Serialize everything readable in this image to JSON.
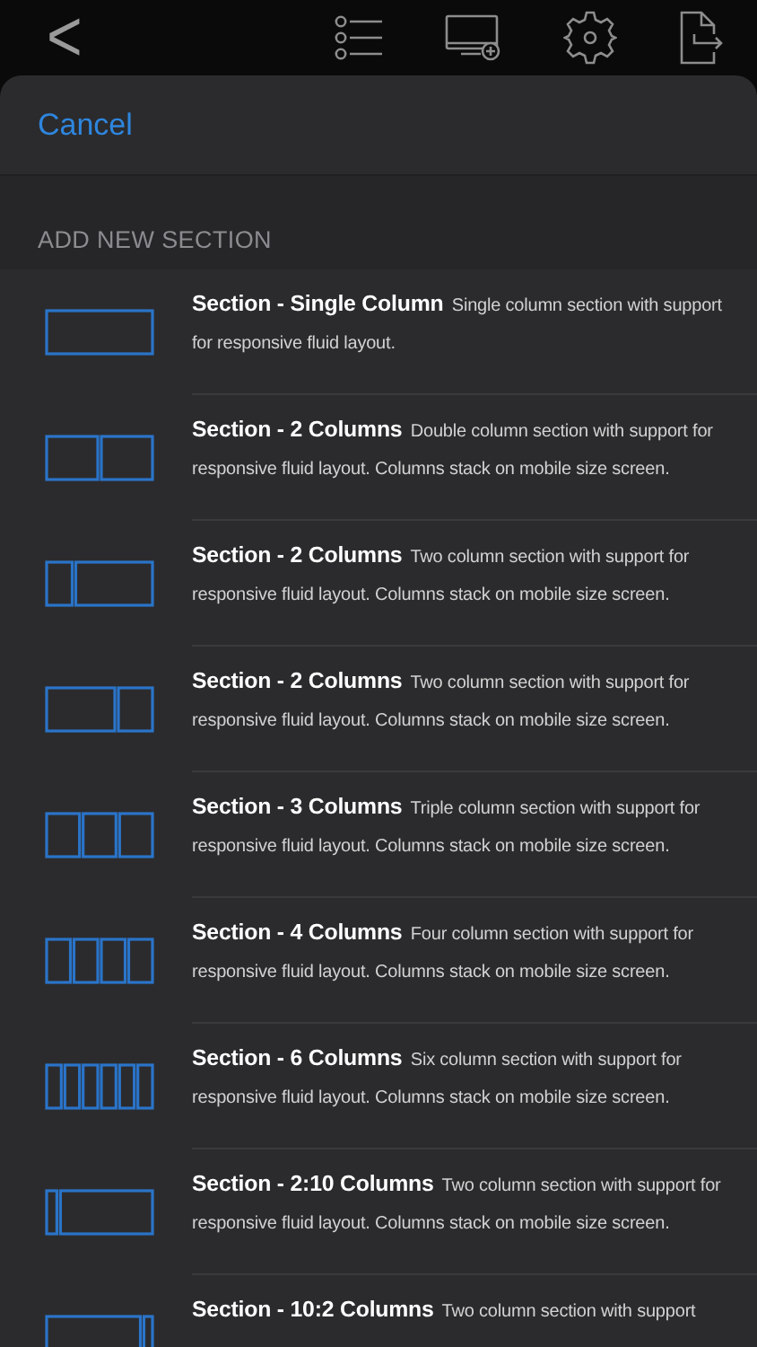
{
  "toolbar": {
    "back": "<"
  },
  "sheet": {
    "cancel": "Cancel",
    "header": "ADD NEW SECTION"
  },
  "sections": [
    {
      "title": "Section - Single Column",
      "description": "Single column section with support for responsive fluid layout.",
      "kind": "single"
    },
    {
      "title": "Section - 2 Columns",
      "description": "Double column section with support for responsive fluid layout.  Columns stack on mobile size screen.",
      "kind": "halves"
    },
    {
      "title": "Section - 2 Columns",
      "description": "Two column section with support for responsive fluid layout.  Columns stack on mobile size screen.",
      "kind": "narrow-wide"
    },
    {
      "title": "Section - 2 Columns",
      "description": "Two column section with support for responsive fluid layout.  Columns stack on mobile size screen.",
      "kind": "wide-narrow"
    },
    {
      "title": "Section - 3 Columns",
      "description": "Triple column section with support for responsive fluid layout. Columns stack on mobile size screen.",
      "kind": "thirds"
    },
    {
      "title": "Section - 4 Columns",
      "description": "Four column section with support for responsive fluid layout. Columns stack on mobile size screen.",
      "kind": "quarters"
    },
    {
      "title": "Section - 6 Columns",
      "description": "Six column section with support for responsive fluid layout.  Columns stack on mobile size screen.",
      "kind": "sixths"
    },
    {
      "title": "Section - 2:10 Columns",
      "description": "Two column section with support for responsive fluid layout.  Columns stack on mobile size screen.",
      "kind": "sliver-wide"
    },
    {
      "title": "Section - 10:2 Columns",
      "description": "Two column section with support",
      "kind": "wide-sliver"
    }
  ]
}
